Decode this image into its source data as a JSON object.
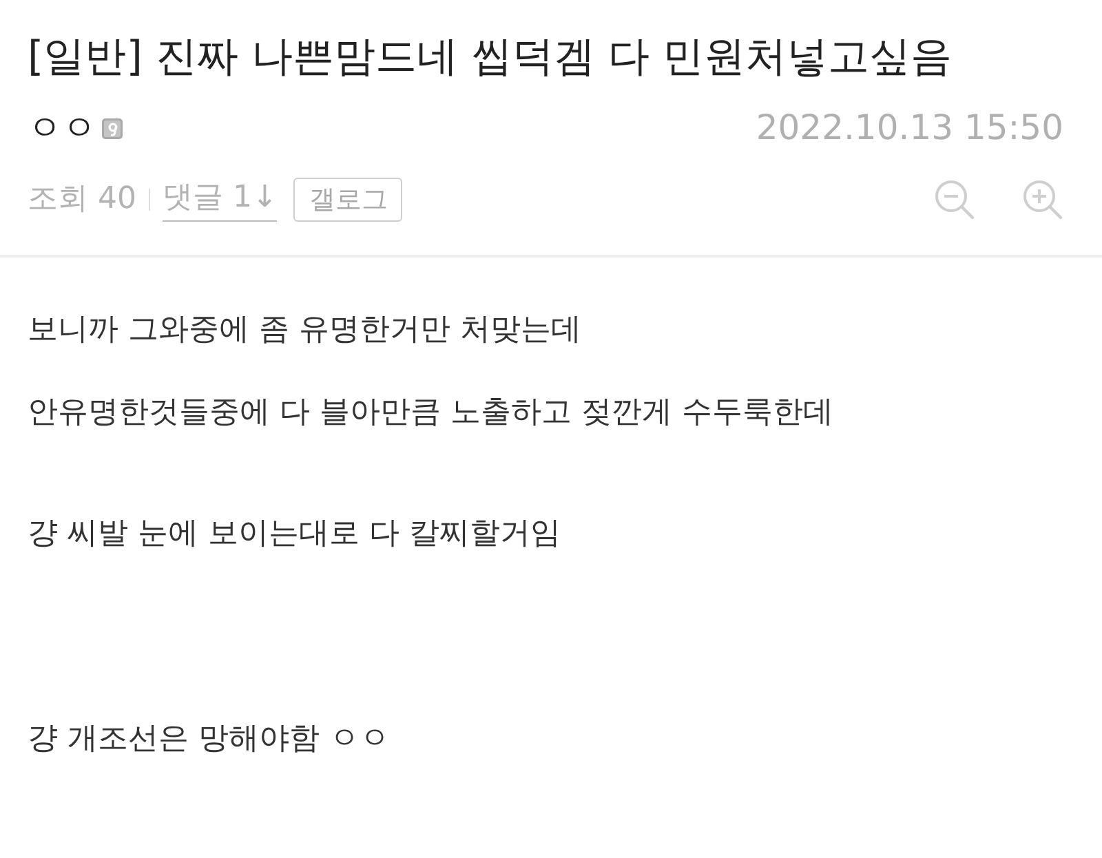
{
  "post": {
    "title": "[일반] 진짜 나쁜맘드네 씹덕겜 다 민원처넣고싶음",
    "author": "ㅇㅇ",
    "date": "2022.10.13 15:50"
  },
  "stats": {
    "views": "조회 40",
    "comments_link": "댓글 1↓",
    "gallog_button": "갤로그"
  },
  "body": {
    "paragraphs": [
      "보니까 그와중에 좀 유명한거만 처맞는데",
      "안유명한것들중에 다 블아만큼 노출하고 젖깐게 수두룩한데",
      "걍 씨발 눈에 보이는대로 다 칼찌할거임",
      "걍 개조선은 망해야함 ㅇㅇ"
    ]
  }
}
